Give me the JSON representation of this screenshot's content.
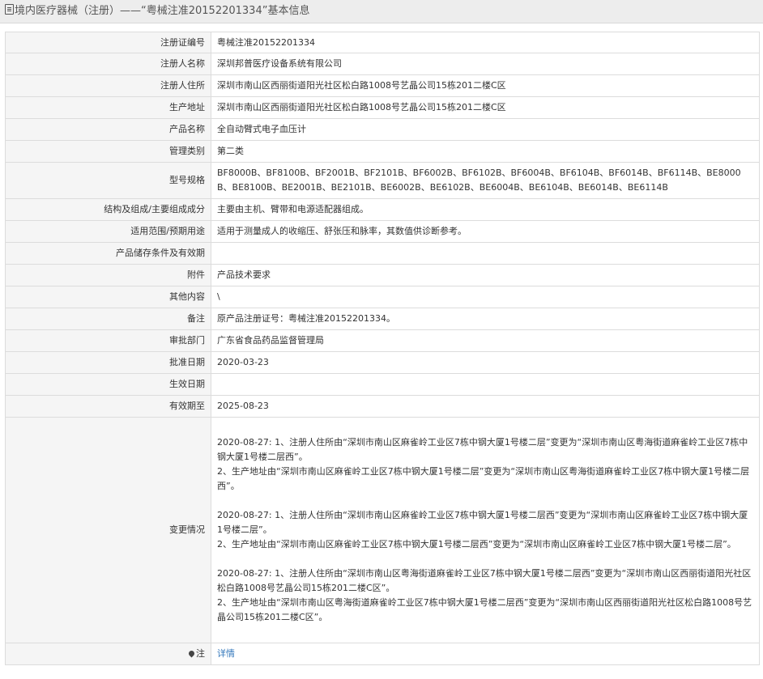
{
  "header": {
    "title": "境内医疗器械（注册）——“粤械注准20152201334”基本信息",
    "icon": "document-icon"
  },
  "rows": [
    {
      "label": "注册证编号",
      "value": "粤械注准20152201334"
    },
    {
      "label": "注册人名称",
      "value": "深圳邦普医疗设备系统有限公司"
    },
    {
      "label": "注册人住所",
      "value": "深圳市南山区西丽街道阳光社区松白路1008号艺晶公司15栋201二楼C区"
    },
    {
      "label": "生产地址",
      "value": "深圳市南山区西丽街道阳光社区松白路1008号艺晶公司15栋201二楼C区"
    },
    {
      "label": "产品名称",
      "value": "全自动臂式电子血压计"
    },
    {
      "label": "管理类别",
      "value": "第二类"
    },
    {
      "label": "型号规格",
      "value": "BF8000B、BF8100B、BF2001B、BF2101B、BF6002B、BF6102B、BF6004B、BF6104B、BF6014B、BF6114B、BE8000B、BE8100B、BE2001B、BE2101B、BE6002B、BE6102B、BE6004B、BE6104B、BE6014B、BE6114B"
    },
    {
      "label": "结构及组成/主要组成成分",
      "value": "主要由主机、臂带和电源适配器组成。"
    },
    {
      "label": "适用范围/预期用途",
      "value": "适用于测量成人的收缩压、舒张压和脉率，其数值供诊断参考。"
    },
    {
      "label": "产品储存条件及有效期",
      "value": ""
    },
    {
      "label": "附件",
      "value": "产品技术要求"
    },
    {
      "label": "其他内容",
      "value": "\\"
    },
    {
      "label": "备注",
      "value": "原产品注册证号：粤械注准20152201334。"
    },
    {
      "label": "审批部门",
      "value": "广东省食品药品监督管理局"
    },
    {
      "label": "批准日期",
      "value": "2020-03-23"
    },
    {
      "label": "生效日期",
      "value": ""
    },
    {
      "label": "有效期至",
      "value": "2025-08-23"
    }
  ],
  "changes": {
    "label": "变更情况",
    "entries": [
      {
        "line1": "2020-08-27: 1、注册人住所由“深圳市南山区麻雀岭工业区7栋中钢大厦1号楼二层”变更为“深圳市南山区粤海街道麻雀岭工业区7栋中钢大厦1号楼二层西”。",
        "line2": "2、生产地址由“深圳市南山区麻雀岭工业区7栋中钢大厦1号楼二层”变更为“深圳市南山区粤海街道麻雀岭工业区7栋中钢大厦1号楼二层西”。"
      },
      {
        "line1": "2020-08-27: 1、注册人住所由“深圳市南山区麻雀岭工业区7栋中钢大厦1号楼二层西”变更为“深圳市南山区麻雀岭工业区7栋中钢大厦1号楼二层”。",
        "line2": "2、生产地址由“深圳市南山区麻雀岭工业区7栋中钢大厦1号楼二层西”变更为“深圳市南山区麻雀岭工业区7栋中钢大厦1号楼二层”。"
      },
      {
        "line1": "2020-08-27: 1、注册人住所由“深圳市南山区粤海街道麻雀岭工业区7栋中钢大厦1号楼二层西”变更为“深圳市南山区西丽街道阳光社区松白路1008号艺晶公司15栋201二楼C区”。",
        "line2": "2、生产地址由“深圳市南山区粤海街道麻雀岭工业区7栋中钢大厦1号楼二层西”变更为“深圳市南山区西丽街道阳光社区松白路1008号艺晶公司15栋201二楼C区”。"
      }
    ]
  },
  "note": {
    "label": "注",
    "icon": "pin-icon",
    "link_text": "详情"
  }
}
